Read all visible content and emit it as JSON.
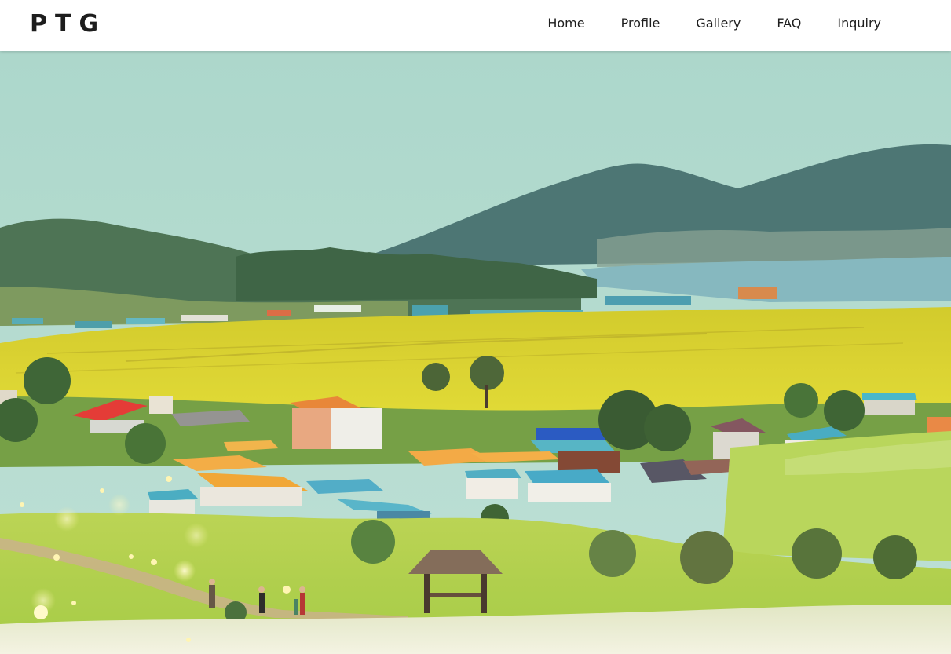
{
  "brand": {
    "logo_text": "PTG"
  },
  "nav": {
    "items": [
      {
        "label": "Home"
      },
      {
        "label": "Profile"
      },
      {
        "label": "Gallery"
      },
      {
        "label": "FAQ"
      },
      {
        "label": "Inquiry"
      }
    ]
  },
  "hero": {
    "image_subject": "countryside-village-landscape",
    "colors": {
      "sky": "#a9d8cc",
      "mountain": "#3f6b6a",
      "sea": "#7fb5bf",
      "field": "#d8d020",
      "grass": "#b8d84a",
      "flowers": "#eef0d8"
    }
  }
}
